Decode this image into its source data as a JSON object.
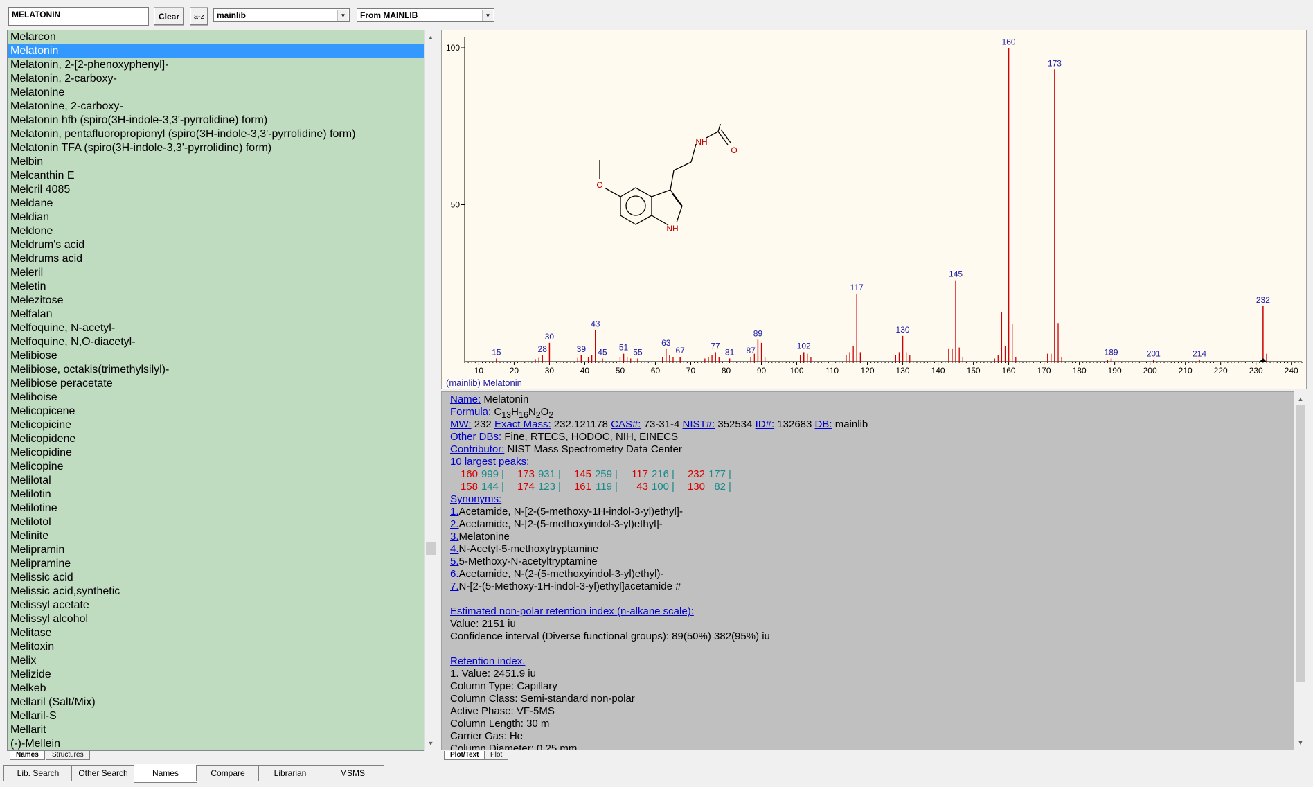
{
  "toolbar": {
    "search_value": "MELATONIN",
    "clear_label": "Clear",
    "az_label": "a-z",
    "library_select": "mainlib",
    "source_select": "From MAINLIB"
  },
  "list": {
    "items": [
      "Melarcon",
      "Melatonin",
      "Melatonin, 2-[2-phenoxyphenyl]-",
      "Melatonin, 2-carboxy-",
      "Melatonine",
      "Melatonine, 2-carboxy-",
      "Melatonin hfb (spiro(3H-indole-3,3'-pyrrolidine) form)",
      "Melatonin, pentafluoropropionyl  (spiro(3H-indole-3,3'-pyrrolidine) form)",
      "Melatonin TFA (spiro(3H-indole-3,3'-pyrrolidine) form)",
      "Melbin",
      "Melcanthin E",
      "Melcril 4085",
      "Meldane",
      "Meldian",
      "Meldone",
      "Meldrum's acid",
      "Meldrums acid",
      "Meleril",
      "Meletin",
      "Melezitose",
      "Melfalan",
      "Melfoquine, N-acetyl-",
      "Melfoquine, N,O-diacetyl-",
      "Melibiose",
      "Melibiose, octakis(trimethylsilyl)-",
      "Melibiose peracetate",
      "Meliboise",
      "Melicopicene",
      "Melicopicine",
      "Melicopidene",
      "Melicopidine",
      "Melicopine",
      "Melilotal",
      "Melilotin",
      "Melilotine",
      "Melilotol",
      "Melinite",
      "Melipramin",
      "Melipramine",
      "Melissic acid",
      "Melissic acid,synthetic",
      "Melissyl acetate",
      "Melissyl alcohol",
      "Melitase",
      "Melitoxin",
      "Melix",
      "Melizide",
      "Melkeb",
      "Mellaril (Salt/Mix)",
      "Mellaril-S",
      "Mellarit",
      "(-)-Mellein"
    ],
    "selected_index": 1
  },
  "left_tabs": [
    "Names",
    "Structures"
  ],
  "plot": {
    "caption": "(mainlib) Melatonin",
    "structure_labels": {
      "nh_amide": "NH",
      "o_carbonyl": "O",
      "o_ether": "O",
      "nh_indole": "NH"
    }
  },
  "chart_data": {
    "type": "bar",
    "xlim": [
      6,
      243
    ],
    "ylim": [
      0,
      100
    ],
    "x_ticks": [
      10,
      20,
      30,
      40,
      50,
      60,
      70,
      80,
      90,
      100,
      110,
      120,
      130,
      140,
      150,
      160,
      170,
      180,
      190,
      200,
      210,
      220,
      230,
      240
    ],
    "y_ticks": [
      100,
      50
    ],
    "labeled_peaks": [
      {
        "mz": 15,
        "rel": 1
      },
      {
        "mz": 28,
        "rel": 2
      },
      {
        "mz": 30,
        "rel": 6
      },
      {
        "mz": 39,
        "rel": 2
      },
      {
        "mz": 43,
        "rel": 10
      },
      {
        "mz": 45,
        "rel": 1
      },
      {
        "mz": 51,
        "rel": 2.5
      },
      {
        "mz": 55,
        "rel": 1
      },
      {
        "mz": 63,
        "rel": 4
      },
      {
        "mz": 67,
        "rel": 1.5
      },
      {
        "mz": 77,
        "rel": 3
      },
      {
        "mz": 81,
        "rel": 1
      },
      {
        "mz": 87,
        "rel": 1.5
      },
      {
        "mz": 89,
        "rel": 7
      },
      {
        "mz": 102,
        "rel": 3
      },
      {
        "mz": 117,
        "rel": 21.6
      },
      {
        "mz": 130,
        "rel": 8.2
      },
      {
        "mz": 145,
        "rel": 25.9
      },
      {
        "mz": 160,
        "rel": 99.9
      },
      {
        "mz": 173,
        "rel": 93.1
      },
      {
        "mz": 189,
        "rel": 1
      },
      {
        "mz": 201,
        "rel": 0.5
      },
      {
        "mz": 214,
        "rel": 0.5
      },
      {
        "mz": 232,
        "rel": 17.7
      }
    ],
    "minor_peaks": [
      {
        "mz": 26,
        "rel": 0.8
      },
      {
        "mz": 27,
        "rel": 1.2
      },
      {
        "mz": 38,
        "rel": 1.2
      },
      {
        "mz": 41,
        "rel": 1.5
      },
      {
        "mz": 42,
        "rel": 2
      },
      {
        "mz": 50,
        "rel": 1.5
      },
      {
        "mz": 52,
        "rel": 1.5
      },
      {
        "mz": 53,
        "rel": 1
      },
      {
        "mz": 62,
        "rel": 1.5
      },
      {
        "mz": 64,
        "rel": 2
      },
      {
        "mz": 65,
        "rel": 1.5
      },
      {
        "mz": 74,
        "rel": 1
      },
      {
        "mz": 75,
        "rel": 1.5
      },
      {
        "mz": 76,
        "rel": 2
      },
      {
        "mz": 78,
        "rel": 1.5
      },
      {
        "mz": 88,
        "rel": 2.5
      },
      {
        "mz": 90,
        "rel": 6
      },
      {
        "mz": 91,
        "rel": 1.5
      },
      {
        "mz": 101,
        "rel": 2
      },
      {
        "mz": 103,
        "rel": 2.5
      },
      {
        "mz": 104,
        "rel": 1.5
      },
      {
        "mz": 114,
        "rel": 2
      },
      {
        "mz": 115,
        "rel": 3
      },
      {
        "mz": 116,
        "rel": 5
      },
      {
        "mz": 118,
        "rel": 3
      },
      {
        "mz": 128,
        "rel": 2
      },
      {
        "mz": 129,
        "rel": 3
      },
      {
        "mz": 131,
        "rel": 3
      },
      {
        "mz": 132,
        "rel": 2
      },
      {
        "mz": 143,
        "rel": 4
      },
      {
        "mz": 144,
        "rel": 4
      },
      {
        "mz": 146,
        "rel": 4.5
      },
      {
        "mz": 147,
        "rel": 1.5
      },
      {
        "mz": 156,
        "rel": 1
      },
      {
        "mz": 157,
        "rel": 2
      },
      {
        "mz": 158,
        "rel": 15.8
      },
      {
        "mz": 159,
        "rel": 5
      },
      {
        "mz": 161,
        "rel": 11.9
      },
      {
        "mz": 162,
        "rel": 1.5
      },
      {
        "mz": 171,
        "rel": 2.5
      },
      {
        "mz": 172,
        "rel": 2.5
      },
      {
        "mz": 174,
        "rel": 12.3
      },
      {
        "mz": 175,
        "rel": 1.5
      },
      {
        "mz": 188,
        "rel": 0.6
      },
      {
        "mz": 233,
        "rel": 2.5
      }
    ]
  },
  "details": {
    "name_label": "Name:",
    "name_value": "Melatonin",
    "formula_label": "Formula:",
    "formula_parts": [
      "C",
      "13",
      "H",
      "16",
      "N",
      "2",
      "O",
      "2"
    ],
    "mw_label": "MW:",
    "mw_value": "232",
    "exact_label": "Exact Mass:",
    "exact_value": "232.121178",
    "cas_label": "CAS#:",
    "cas_value": "73-31-4",
    "nist_label": "NIST#:",
    "nist_value": "352534",
    "id_label": "ID#:",
    "id_value": "132683",
    "db_label": "DB:",
    "db_value": "mainlib",
    "other_label": "Other DBs:",
    "other_value": "Fine, RTECS, HODOC, NIH, EINECS",
    "contrib_label": "Contributor:",
    "contrib_value": "NIST Mass Spectrometry Data Center",
    "largest_label": "10 largest peaks:",
    "peaks_row1": [
      [
        "160",
        "999"
      ],
      [
        "173",
        "931"
      ],
      [
        "145",
        "259"
      ],
      [
        "117",
        "216"
      ],
      [
        "232",
        "177"
      ]
    ],
    "peaks_row2": [
      [
        "158",
        "144"
      ],
      [
        "174",
        "123"
      ],
      [
        "161",
        "119"
      ],
      [
        "43",
        "100"
      ],
      [
        "130",
        "82"
      ]
    ],
    "syn_label": "Synonyms:",
    "synonyms": [
      {
        "n": "1.",
        "t": "Acetamide, N-[2-(5-methoxy-1H-indol-3-yl)ethyl]-"
      },
      {
        "n": "2.",
        "t": "Acetamide, N-[2-(5-methoxyindol-3-yl)ethyl]-"
      },
      {
        "n": "3.",
        "t": "Melatonine"
      },
      {
        "n": "4.",
        "t": "N-Acetyl-5-methoxytryptamine"
      },
      {
        "n": "5.",
        "t": "5-Methoxy-N-acetyltryptamine"
      },
      {
        "n": "6.",
        "t": "Acetamide, N-(2-(5-methoxyindol-3-yl)ethyl)-"
      },
      {
        "n": "7.",
        "t": "N-[2-(5-Methoxy-1H-indol-3-yl)ethyl]acetamide  #"
      }
    ],
    "ri_est_label": "Estimated non-polar retention index (n-alkane scale):",
    "ri_est_value": "Value: 2151 iu",
    "ri_est_conf": "Confidence interval (Diverse functional groups):  89(50%) 382(95%) iu",
    "ri_label": "Retention index.",
    "ri_lines": [
      "1. Value: 2451.9 iu",
      "Column Type: Capillary",
      "Column Class: Semi-standard non-polar",
      "Active Phase: VF-5MS",
      "Column Length: 30 m",
      "Carrier Gas: He",
      "Column Diameter: 0.25 mm"
    ]
  },
  "detail_tabs": [
    "Plot/Text",
    "Plot"
  ],
  "bottom_tabs": [
    "Lib. Search",
    "Other Search",
    "Names",
    "Compare",
    "Librarian",
    "MSMS"
  ],
  "bottom_active": 2
}
